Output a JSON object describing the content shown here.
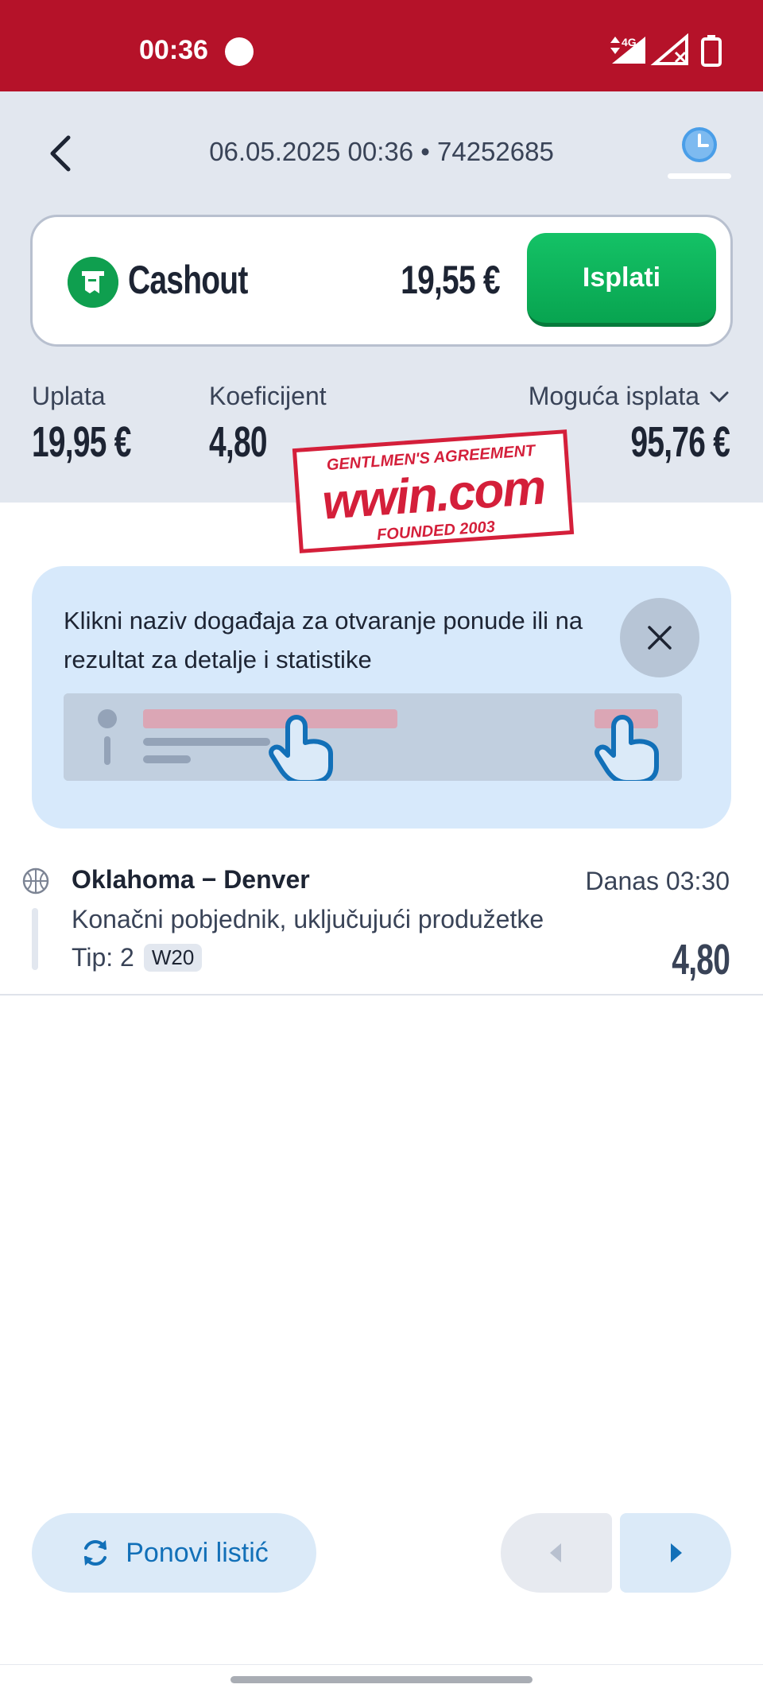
{
  "status_bar": {
    "time": "00:36",
    "network": "4G"
  },
  "header": {
    "title": "06.05.2025 00:36 • 74252685",
    "icons": [
      "back-arrow-icon",
      "clock-icon"
    ]
  },
  "cashout": {
    "label": "Cashout",
    "amount": "19,55 €",
    "button_label": "Isplati",
    "accent_color": "#0fae58"
  },
  "stats": {
    "uplata_label": "Uplata",
    "uplata_value": "19,95 €",
    "koeficijent_label": "Koeficijent",
    "koeficijent_value": "4,80",
    "moguca_label": "Moguća isplata",
    "moguca_value": "95,76 €"
  },
  "stamp": {
    "top": "GENTLMEN'S AGREEMENT",
    "logo": "wwin.com",
    "bottom": "FOUNDED 2003"
  },
  "tip": {
    "text": "Klikni naziv događaja za otvaranje ponude ili na rezultat za detalje i statistike"
  },
  "event": {
    "teams": "Oklahoma − Denver",
    "time": "Danas 03:30",
    "market": "Konačni pobjednik, uključujući produžetke",
    "tip_label": "Tip: 2",
    "badge": "W20",
    "odd": "4,80",
    "sport_icon": "basketball-icon"
  },
  "footer": {
    "repeat_label": "Ponovi listić"
  },
  "colors": {
    "brand_red": "#b51229",
    "header_bg": "#e2e7ef",
    "link_blue": "#1270b8"
  }
}
